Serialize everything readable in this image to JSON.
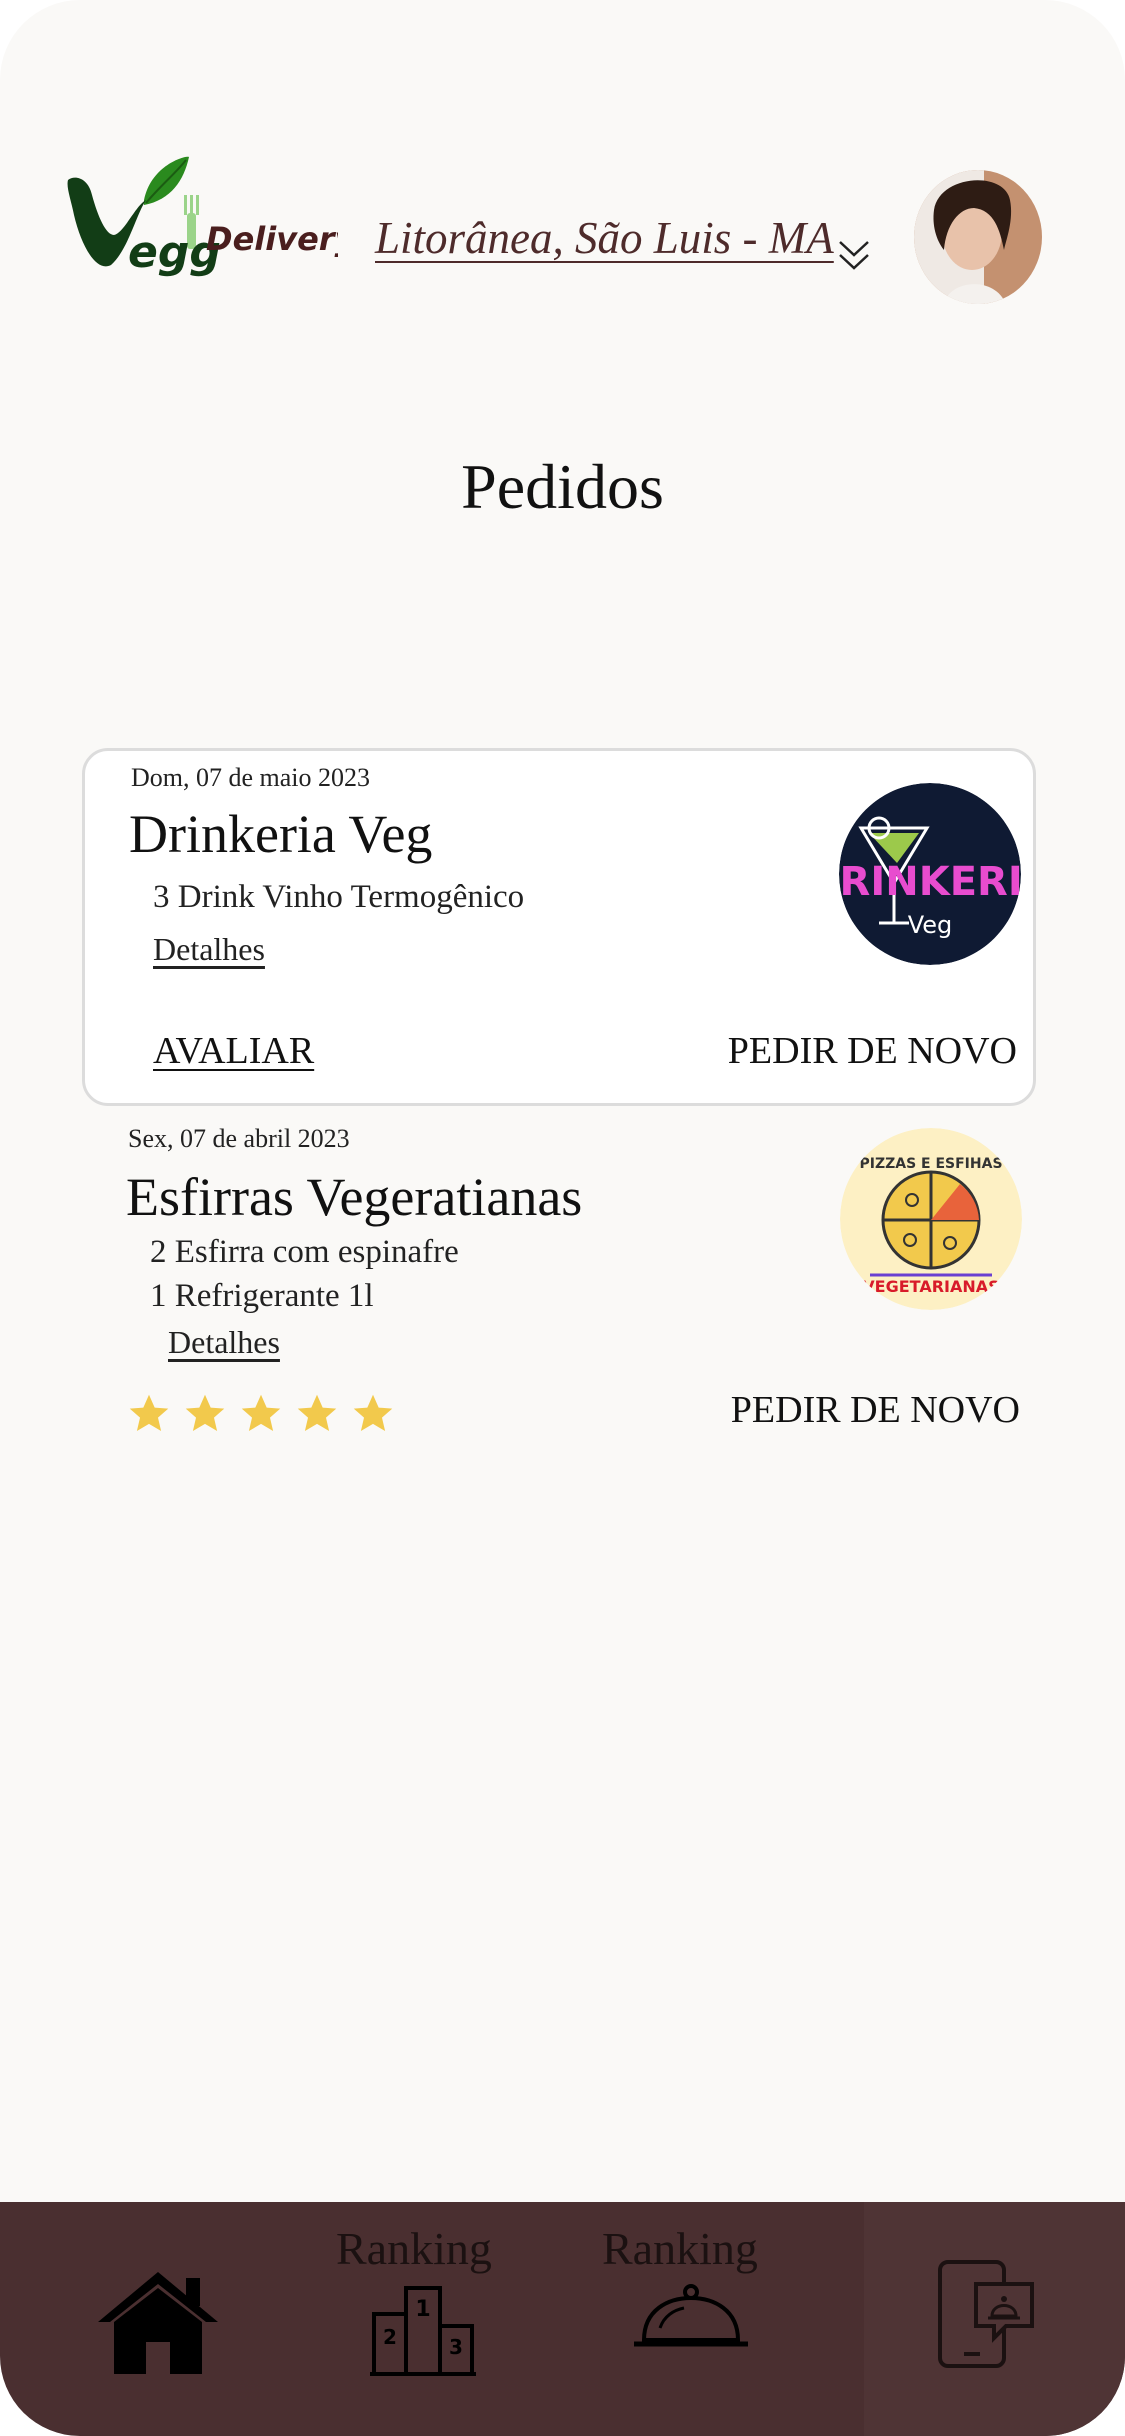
{
  "header": {
    "brand": "VeggDelivery",
    "location": "Litorânea, São Luis - MA"
  },
  "page": {
    "title": "Pedidos"
  },
  "orders": [
    {
      "date": "Dom, 07 de maio 2023",
      "store": "Drinkeria Veg",
      "items": [
        "3 Drink Vinho Termogênico"
      ],
      "details_label": "Detalhes",
      "rate_label": "AVALIAR",
      "reorder_label": "PEDIR DE NOVO",
      "logo_text": "DRINKERIA",
      "logo_sub": "Veg"
    },
    {
      "date": "Sex, 07 de abril 2023",
      "store": "Esfirras Vegeratianas",
      "items": [
        "2 Esfirra com espinafre",
        "1 Refrigerante 1l"
      ],
      "details_label": "Detalhes",
      "rating": 5,
      "reorder_label": "PEDIR DE NOVO",
      "logo_top": "PIZZAS E ESFIHAS",
      "logo_bottom": "VEGETARIANAS"
    }
  ],
  "nav": {
    "items": [
      {
        "icon": "home-icon"
      },
      {
        "label": "Ranking",
        "icon": "podium-icon"
      },
      {
        "label": "Ranking",
        "icon": "cloche-icon"
      },
      {
        "icon": "chat-phone-icon"
      }
    ]
  },
  "colors": {
    "brand_dark": "#4a2f30",
    "leaf_green": "#2a8a1e",
    "star": "#f2c94c"
  }
}
